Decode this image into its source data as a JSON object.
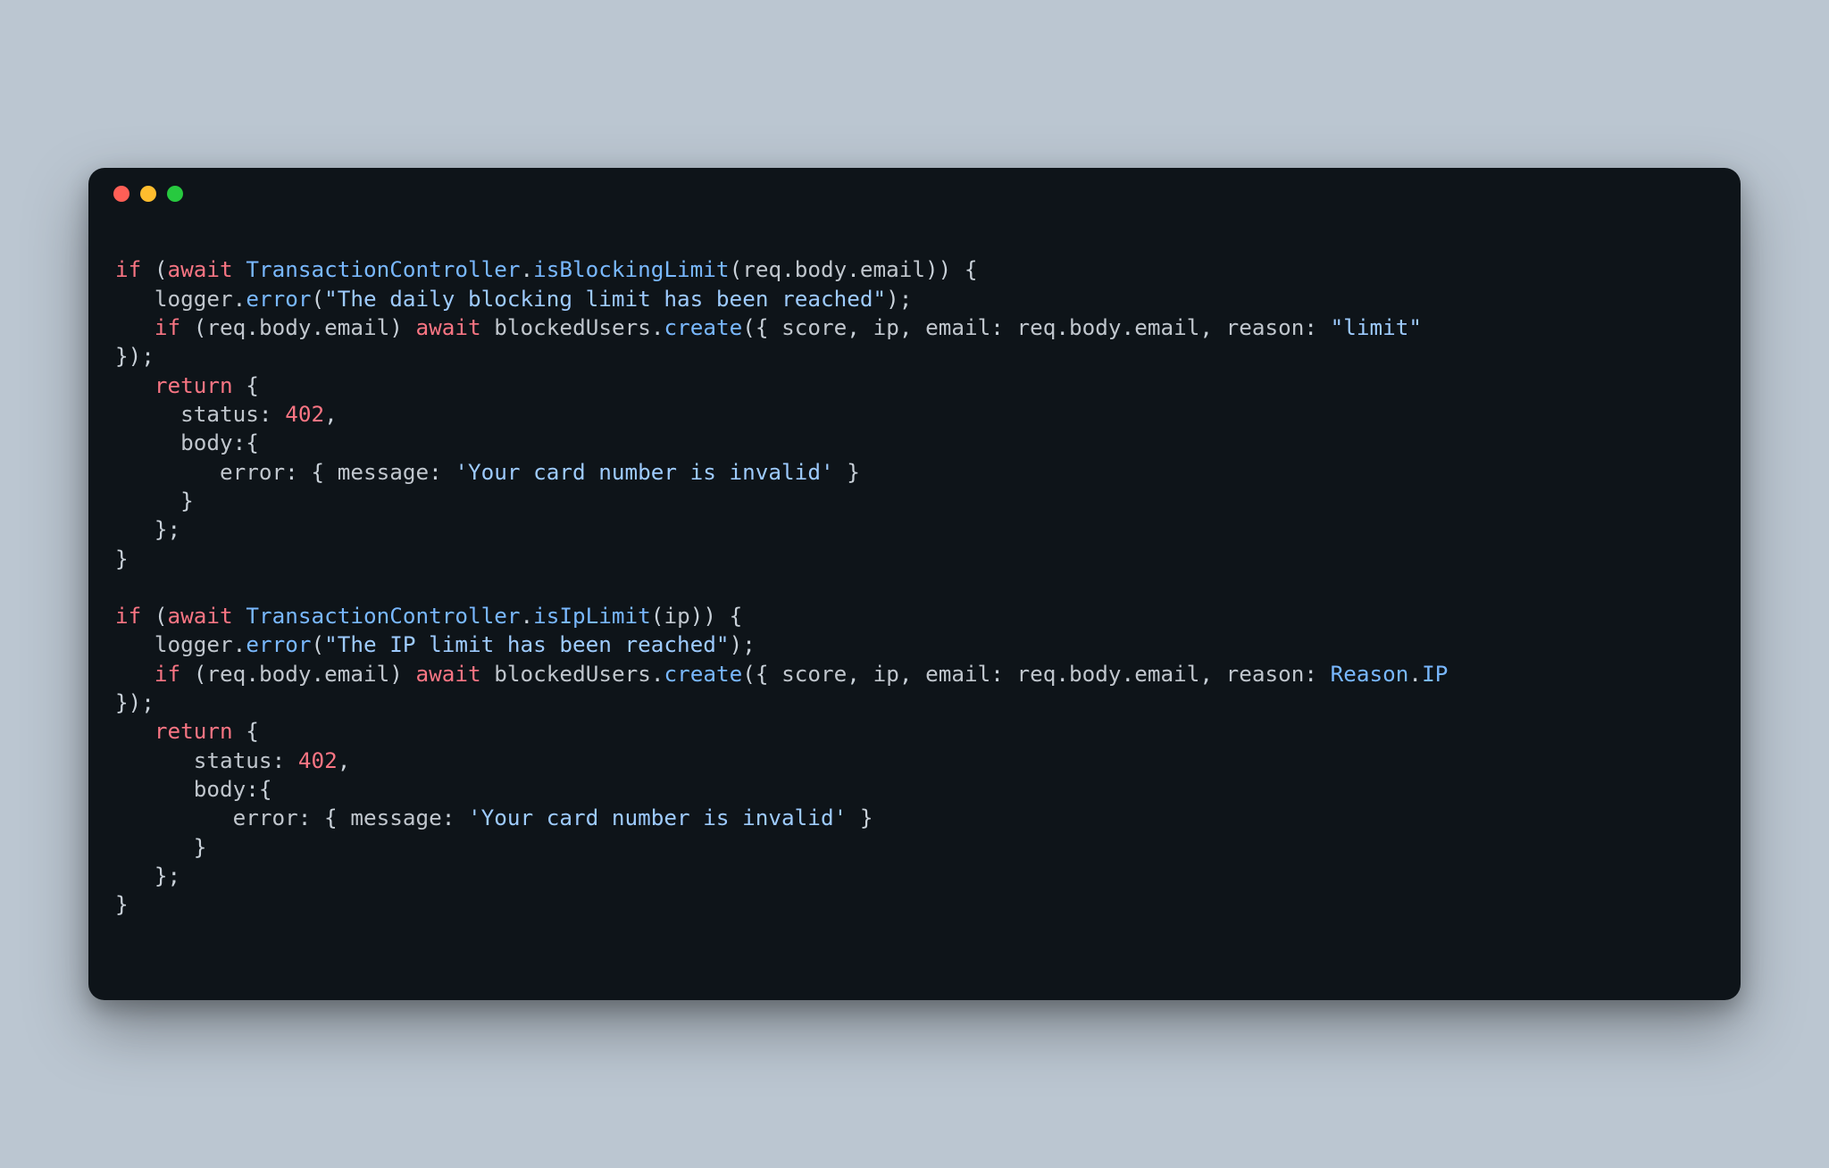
{
  "window": {
    "traffic_lights": [
      "close",
      "minimize",
      "zoom"
    ]
  },
  "code": {
    "tokens": [
      {
        "t": "kw",
        "v": "if"
      },
      {
        "t": "punct",
        "v": " ("
      },
      {
        "t": "kw",
        "v": "await"
      },
      {
        "t": "punct",
        "v": " "
      },
      {
        "t": "method",
        "v": "TransactionController"
      },
      {
        "t": "punct",
        "v": "."
      },
      {
        "t": "method",
        "v": "isBlockingLimit"
      },
      {
        "t": "punct",
        "v": "("
      },
      {
        "t": "ident",
        "v": "req"
      },
      {
        "t": "punct",
        "v": "."
      },
      {
        "t": "ident",
        "v": "body"
      },
      {
        "t": "punct",
        "v": "."
      },
      {
        "t": "ident",
        "v": "email"
      },
      {
        "t": "punct",
        "v": ")) {"
      },
      {
        "t": "nl",
        "v": "\n"
      },
      {
        "t": "punct",
        "v": "   "
      },
      {
        "t": "ident",
        "v": "logger"
      },
      {
        "t": "punct",
        "v": "."
      },
      {
        "t": "method",
        "v": "error"
      },
      {
        "t": "punct",
        "v": "("
      },
      {
        "t": "str",
        "v": "\"The daily blocking limit has been reached\""
      },
      {
        "t": "punct",
        "v": ");"
      },
      {
        "t": "nl",
        "v": "\n"
      },
      {
        "t": "punct",
        "v": "   "
      },
      {
        "t": "kw",
        "v": "if"
      },
      {
        "t": "punct",
        "v": " ("
      },
      {
        "t": "ident",
        "v": "req"
      },
      {
        "t": "punct",
        "v": "."
      },
      {
        "t": "ident",
        "v": "body"
      },
      {
        "t": "punct",
        "v": "."
      },
      {
        "t": "ident",
        "v": "email"
      },
      {
        "t": "punct",
        "v": ") "
      },
      {
        "t": "kw",
        "v": "await"
      },
      {
        "t": "punct",
        "v": " "
      },
      {
        "t": "ident",
        "v": "blockedUsers"
      },
      {
        "t": "punct",
        "v": "."
      },
      {
        "t": "method",
        "v": "create"
      },
      {
        "t": "punct",
        "v": "({ "
      },
      {
        "t": "ident",
        "v": "score"
      },
      {
        "t": "punct",
        "v": ", "
      },
      {
        "t": "ident",
        "v": "ip"
      },
      {
        "t": "punct",
        "v": ", "
      },
      {
        "t": "ident",
        "v": "email"
      },
      {
        "t": "punct",
        "v": ": "
      },
      {
        "t": "ident",
        "v": "req"
      },
      {
        "t": "punct",
        "v": "."
      },
      {
        "t": "ident",
        "v": "body"
      },
      {
        "t": "punct",
        "v": "."
      },
      {
        "t": "ident",
        "v": "email"
      },
      {
        "t": "punct",
        "v": ", "
      },
      {
        "t": "ident",
        "v": "reason"
      },
      {
        "t": "punct",
        "v": ": "
      },
      {
        "t": "str",
        "v": "\"limit\""
      },
      {
        "t": "punct",
        "v": " "
      },
      {
        "t": "nl",
        "v": "\n"
      },
      {
        "t": "punct",
        "v": "});"
      },
      {
        "t": "nl",
        "v": "\n"
      },
      {
        "t": "punct",
        "v": "   "
      },
      {
        "t": "kw",
        "v": "return"
      },
      {
        "t": "punct",
        "v": " {"
      },
      {
        "t": "nl",
        "v": "\n"
      },
      {
        "t": "punct",
        "v": "     "
      },
      {
        "t": "ident",
        "v": "status"
      },
      {
        "t": "punct",
        "v": ": "
      },
      {
        "t": "num",
        "v": "402"
      },
      {
        "t": "punct",
        "v": ","
      },
      {
        "t": "nl",
        "v": "\n"
      },
      {
        "t": "punct",
        "v": "     "
      },
      {
        "t": "ident",
        "v": "body"
      },
      {
        "t": "punct",
        "v": ":{"
      },
      {
        "t": "nl",
        "v": "\n"
      },
      {
        "t": "punct",
        "v": "        "
      },
      {
        "t": "ident",
        "v": "error"
      },
      {
        "t": "punct",
        "v": ": { "
      },
      {
        "t": "ident",
        "v": "message"
      },
      {
        "t": "punct",
        "v": ": "
      },
      {
        "t": "str",
        "v": "'Your card number is invalid'"
      },
      {
        "t": "punct",
        "v": " }"
      },
      {
        "t": "nl",
        "v": "\n"
      },
      {
        "t": "punct",
        "v": "     }"
      },
      {
        "t": "nl",
        "v": "\n"
      },
      {
        "t": "punct",
        "v": "   };"
      },
      {
        "t": "nl",
        "v": "\n"
      },
      {
        "t": "punct",
        "v": "}"
      },
      {
        "t": "nl",
        "v": "\n"
      },
      {
        "t": "nl",
        "v": "\n"
      },
      {
        "t": "kw",
        "v": "if"
      },
      {
        "t": "punct",
        "v": " ("
      },
      {
        "t": "kw",
        "v": "await"
      },
      {
        "t": "punct",
        "v": " "
      },
      {
        "t": "method",
        "v": "TransactionController"
      },
      {
        "t": "punct",
        "v": "."
      },
      {
        "t": "method",
        "v": "isIpLimit"
      },
      {
        "t": "punct",
        "v": "("
      },
      {
        "t": "ident",
        "v": "ip"
      },
      {
        "t": "punct",
        "v": ")) {"
      },
      {
        "t": "nl",
        "v": "\n"
      },
      {
        "t": "punct",
        "v": "   "
      },
      {
        "t": "ident",
        "v": "logger"
      },
      {
        "t": "punct",
        "v": "."
      },
      {
        "t": "method",
        "v": "error"
      },
      {
        "t": "punct",
        "v": "("
      },
      {
        "t": "str",
        "v": "\"The IP limit has been reached\""
      },
      {
        "t": "punct",
        "v": ");"
      },
      {
        "t": "nl",
        "v": "\n"
      },
      {
        "t": "punct",
        "v": "   "
      },
      {
        "t": "kw",
        "v": "if"
      },
      {
        "t": "punct",
        "v": " ("
      },
      {
        "t": "ident",
        "v": "req"
      },
      {
        "t": "punct",
        "v": "."
      },
      {
        "t": "ident",
        "v": "body"
      },
      {
        "t": "punct",
        "v": "."
      },
      {
        "t": "ident",
        "v": "email"
      },
      {
        "t": "punct",
        "v": ") "
      },
      {
        "t": "kw",
        "v": "await"
      },
      {
        "t": "punct",
        "v": " "
      },
      {
        "t": "ident",
        "v": "blockedUsers"
      },
      {
        "t": "punct",
        "v": "."
      },
      {
        "t": "method",
        "v": "create"
      },
      {
        "t": "punct",
        "v": "({ "
      },
      {
        "t": "ident",
        "v": "score"
      },
      {
        "t": "punct",
        "v": ", "
      },
      {
        "t": "ident",
        "v": "ip"
      },
      {
        "t": "punct",
        "v": ", "
      },
      {
        "t": "ident",
        "v": "email"
      },
      {
        "t": "punct",
        "v": ": "
      },
      {
        "t": "ident",
        "v": "req"
      },
      {
        "t": "punct",
        "v": "."
      },
      {
        "t": "ident",
        "v": "body"
      },
      {
        "t": "punct",
        "v": "."
      },
      {
        "t": "ident",
        "v": "email"
      },
      {
        "t": "punct",
        "v": ", "
      },
      {
        "t": "ident",
        "v": "reason"
      },
      {
        "t": "punct",
        "v": ": "
      },
      {
        "t": "method",
        "v": "Reason"
      },
      {
        "t": "punct",
        "v": "."
      },
      {
        "t": "method",
        "v": "IP"
      },
      {
        "t": "punct",
        "v": " "
      },
      {
        "t": "nl",
        "v": "\n"
      },
      {
        "t": "punct",
        "v": "});"
      },
      {
        "t": "nl",
        "v": "\n"
      },
      {
        "t": "punct",
        "v": "   "
      },
      {
        "t": "kw",
        "v": "return"
      },
      {
        "t": "punct",
        "v": " {"
      },
      {
        "t": "nl",
        "v": "\n"
      },
      {
        "t": "punct",
        "v": "      "
      },
      {
        "t": "ident",
        "v": "status"
      },
      {
        "t": "punct",
        "v": ": "
      },
      {
        "t": "num",
        "v": "402"
      },
      {
        "t": "punct",
        "v": ","
      },
      {
        "t": "nl",
        "v": "\n"
      },
      {
        "t": "punct",
        "v": "      "
      },
      {
        "t": "ident",
        "v": "body"
      },
      {
        "t": "punct",
        "v": ":{"
      },
      {
        "t": "nl",
        "v": "\n"
      },
      {
        "t": "punct",
        "v": "         "
      },
      {
        "t": "ident",
        "v": "error"
      },
      {
        "t": "punct",
        "v": ": { "
      },
      {
        "t": "ident",
        "v": "message"
      },
      {
        "t": "punct",
        "v": ": "
      },
      {
        "t": "str",
        "v": "'Your card number is invalid'"
      },
      {
        "t": "punct",
        "v": " }"
      },
      {
        "t": "nl",
        "v": "\n"
      },
      {
        "t": "punct",
        "v": "      }"
      },
      {
        "t": "nl",
        "v": "\n"
      },
      {
        "t": "punct",
        "v": "   };"
      },
      {
        "t": "nl",
        "v": "\n"
      },
      {
        "t": "punct",
        "v": "}"
      }
    ]
  }
}
